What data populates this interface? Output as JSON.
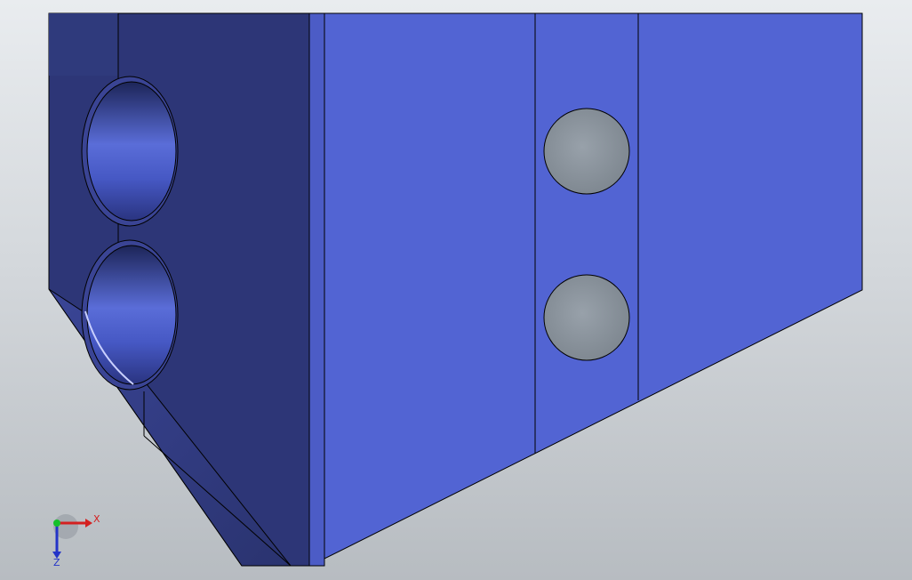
{
  "viewport": {
    "background_top": "#e9ecef",
    "background_bottom": "#b7bcc1"
  },
  "model": {
    "face_colors": {
      "front": "#5264d3",
      "side": "#2d3677",
      "side_light": "#3a4494",
      "hole_wall_light": "#6679e6",
      "hole_wall_dark": "#1e2659",
      "through_hole": "#8b939c",
      "edge": "#000000"
    }
  },
  "triad": {
    "x_label": "X",
    "z_label": "Z",
    "x_color": "#d42020",
    "y_color": "#16c02a",
    "z_color": "#2434c8"
  }
}
